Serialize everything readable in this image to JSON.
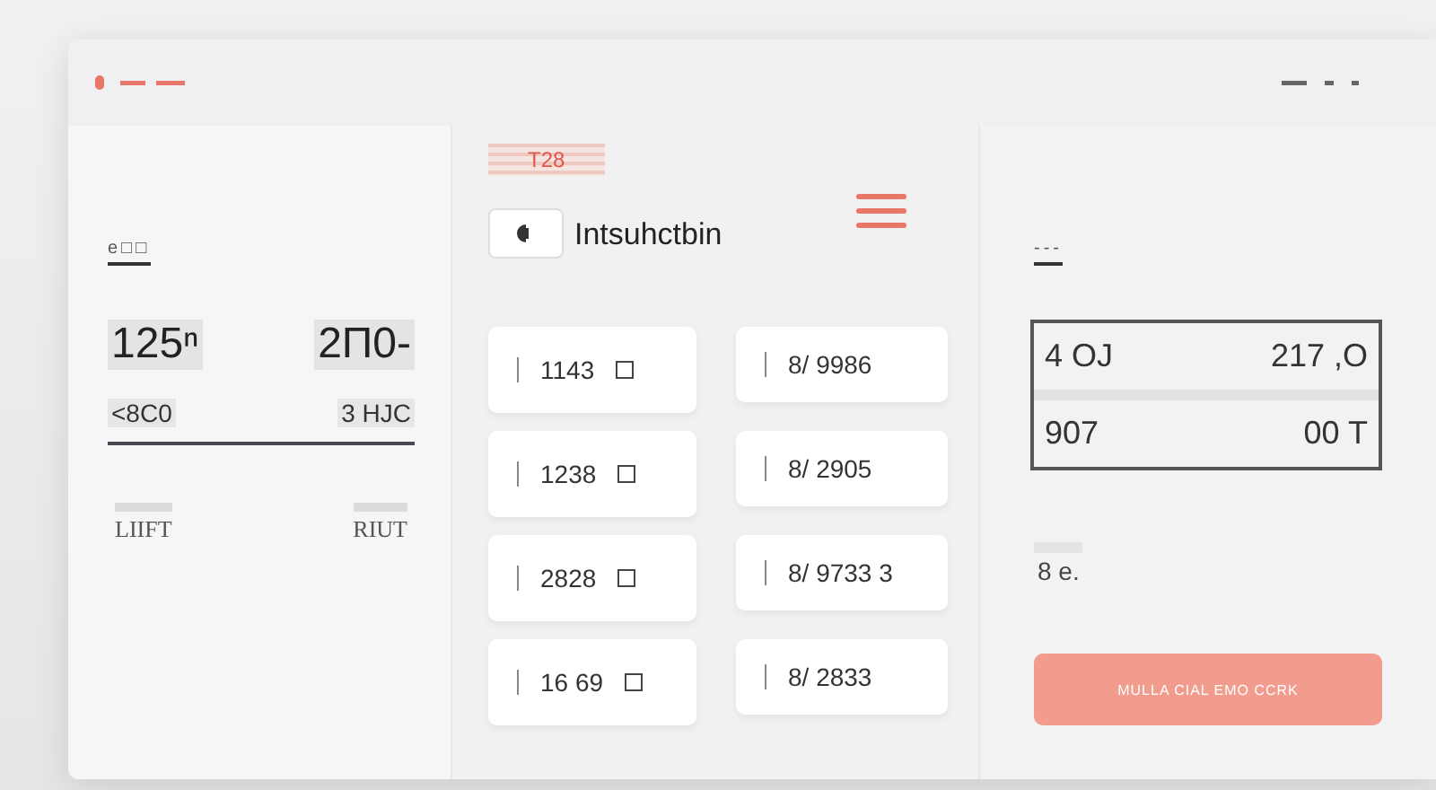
{
  "left_panel": {
    "heading": "e□□",
    "stats": [
      {
        "value": "125",
        "unit": "ⁿ"
      },
      {
        "value": "2П0-"
      }
    ],
    "sub_labels": [
      "<8C0",
      "3 HJC"
    ],
    "footer_labels": [
      "LIIFT",
      "RIUT"
    ]
  },
  "middle_panel": {
    "badge": "T28",
    "title": "Intsuhctbin",
    "cards_left": [
      {
        "text": "1143"
      },
      {
        "text": "1238"
      },
      {
        "text": "2828"
      },
      {
        "text": "16 69"
      }
    ],
    "cards_right": [
      {
        "text": "8/ 9986"
      },
      {
        "text": "8/ 2905"
      },
      {
        "text": "8/ 9733 3"
      },
      {
        "text": "8/ 2833"
      }
    ]
  },
  "right_panel": {
    "heading": "---",
    "rows": [
      [
        "4 OJ",
        "217 ,O"
      ],
      [
        "907",
        "00 T"
      ]
    ],
    "note": "8 e.",
    "button": "MULLA CIAL EMO CCRK"
  }
}
